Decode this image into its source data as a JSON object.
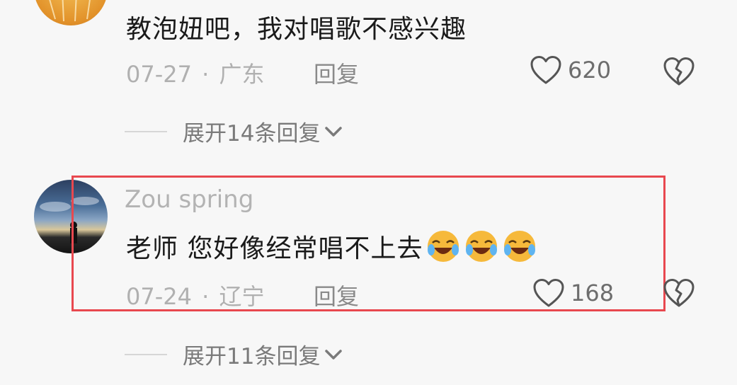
{
  "comments": [
    {
      "text": "教泡妞吧，我对唱歌不感兴趣",
      "date": "07-27",
      "location": "广东",
      "reply_label": "回复",
      "likes": "620",
      "expand_label": "展开14条回复"
    },
    {
      "username": "Zou spring",
      "text": "老师 您好像经常唱不上去",
      "date": "07-24",
      "location": "辽宁",
      "reply_label": "回复",
      "likes": "168",
      "expand_label": "展开11条回复"
    }
  ],
  "separator": "·",
  "colors": {
    "highlight_border": "#e8484f",
    "emoji_face": "#f6b93b"
  },
  "icons": [
    "heart-icon",
    "broken-heart-icon",
    "chevron-down-icon",
    "laughing-crying-emoji"
  ]
}
